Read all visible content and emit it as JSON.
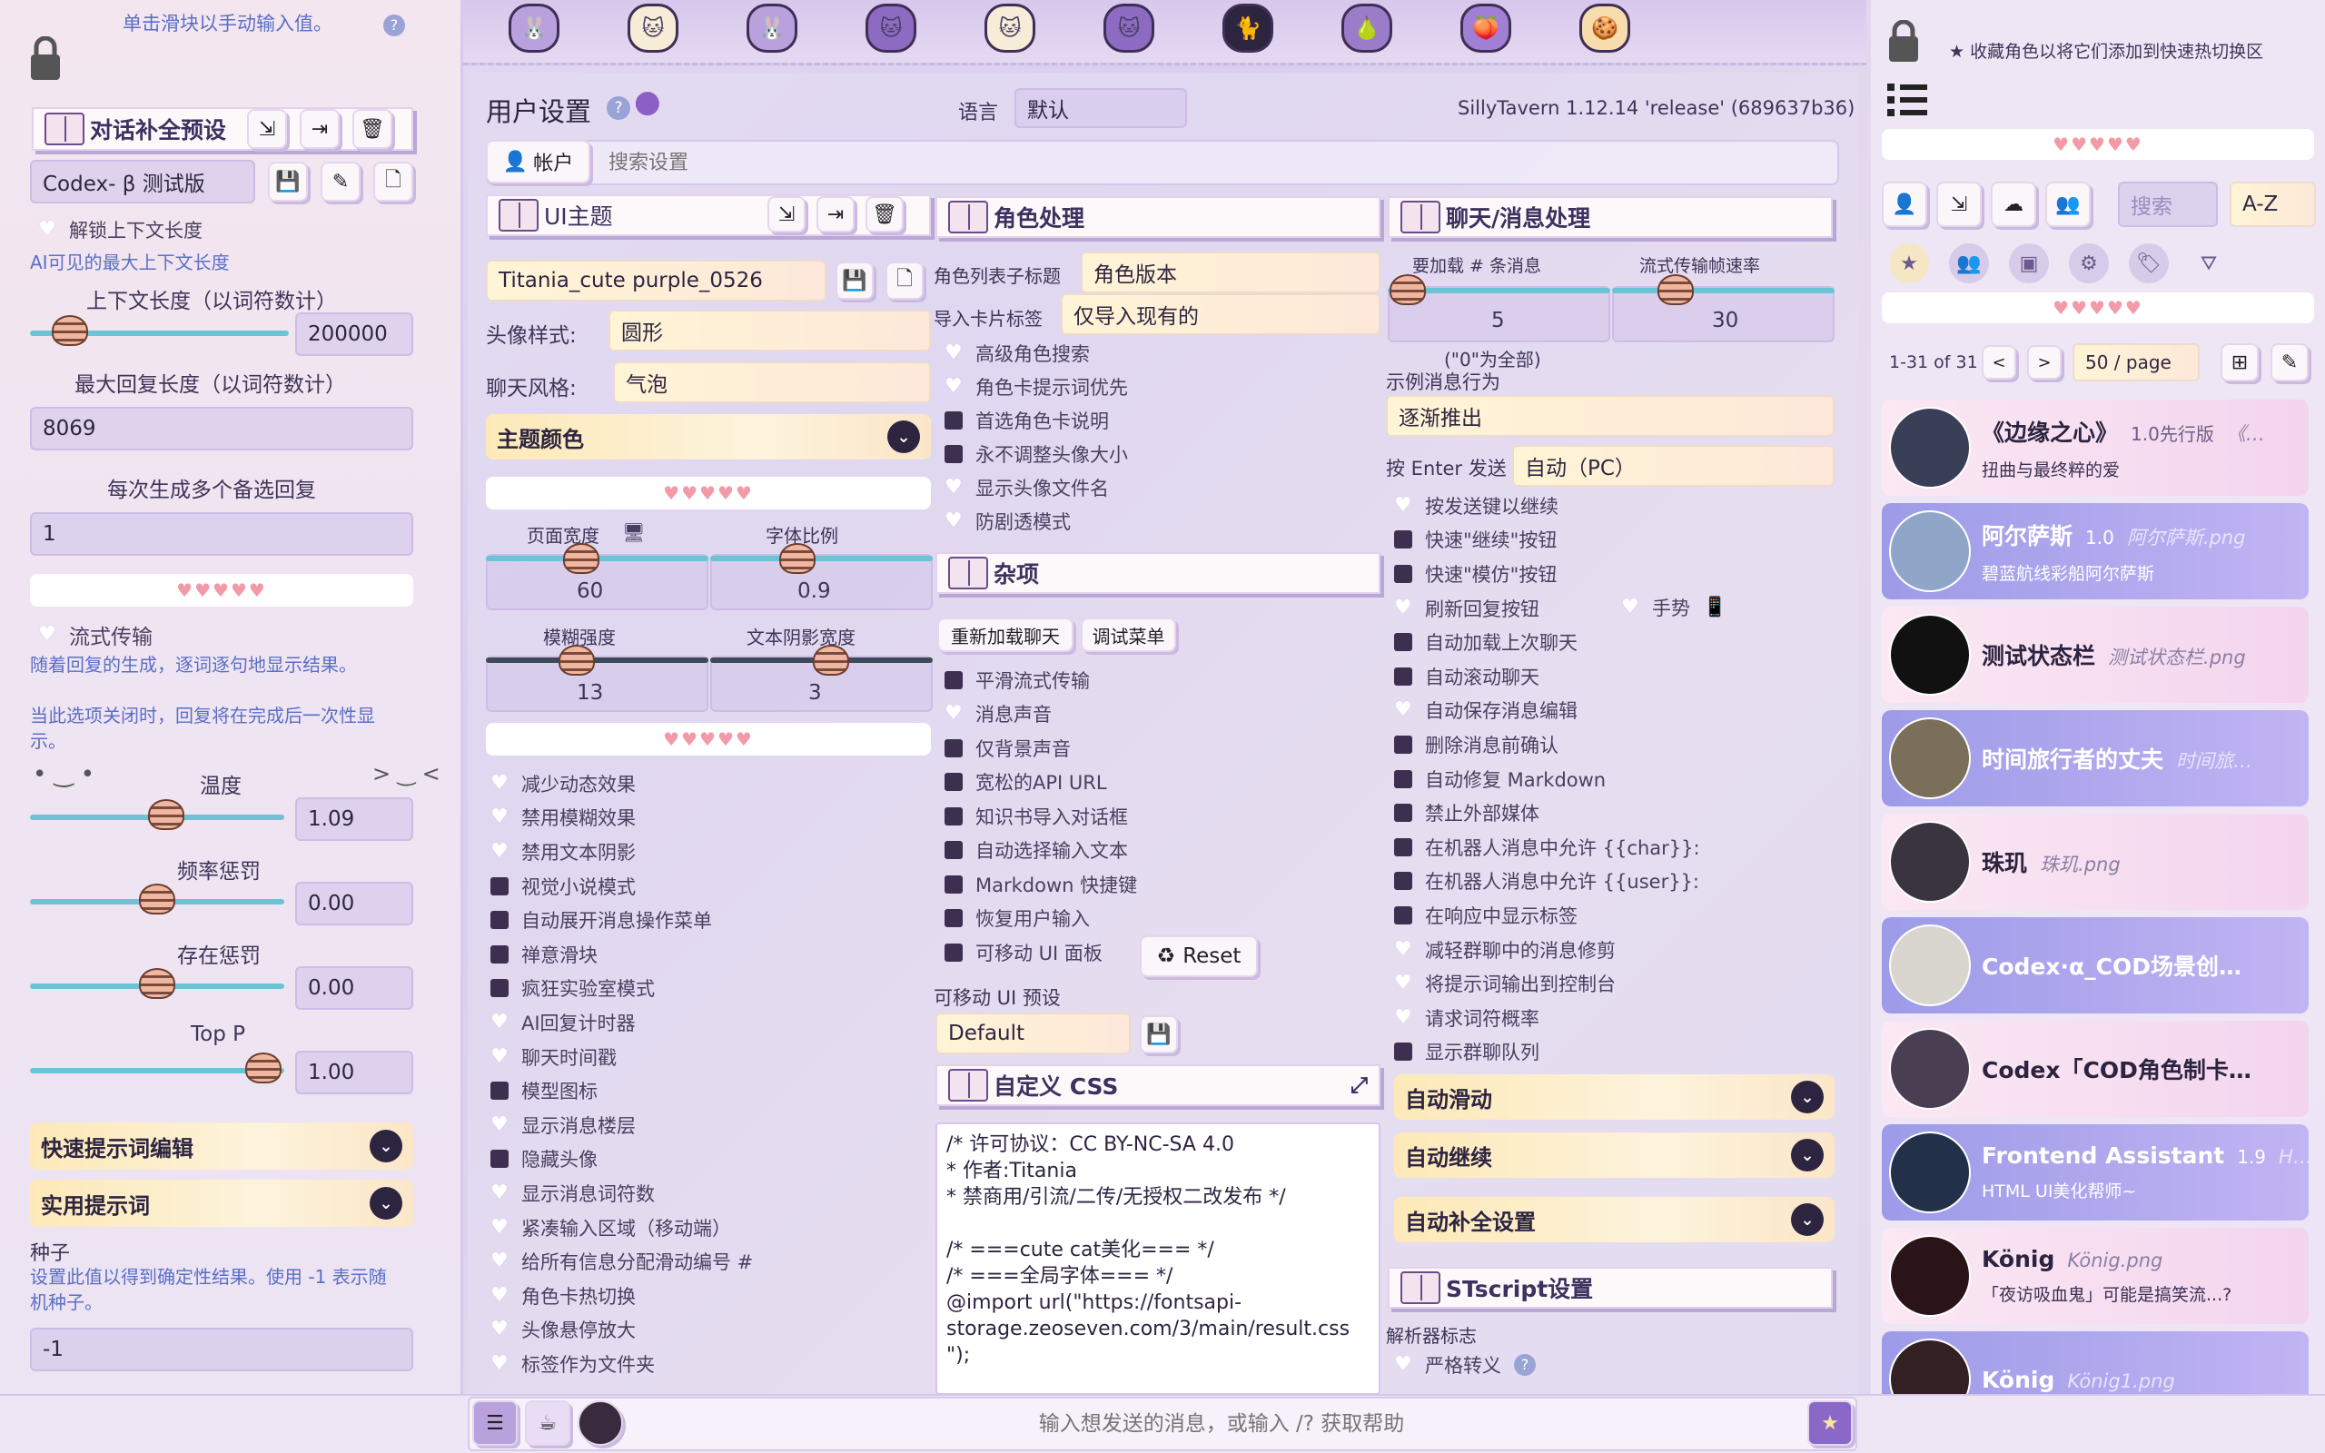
{
  "left": {
    "hint": "单击滑块以手动输入值。",
    "preset_header": "对话补全预设",
    "preset_name": "Codex- β 测试版",
    "unlock_label": "解锁上下文长度",
    "unlock_desc": "AI可见的最大上下文长度",
    "context_label": "上下文长度（以词符数计）",
    "context_value": "200000",
    "max_reply_label": "最大回复长度（以词符数计）",
    "max_reply_value": "8069",
    "multi_label": "每次生成多个备选回复",
    "multi_value": "1",
    "stream_label": "流式传输",
    "stream_desc1": "随着回复的生成，逐词逐句地显示结果。",
    "stream_desc2": "当此选项关闭时，回复将在完成后一次性显示。",
    "temp_label": "温度",
    "temp_value": "1.09",
    "freq_label": "频率惩罚",
    "freq_value": "0.00",
    "pres_label": "存在惩罚",
    "pres_value": "0.00",
    "topp_label": "Top P",
    "topp_value": "1.00",
    "quick_prompt": "快速提示词编辑",
    "util_prompt": "实用提示词",
    "seed_label": "种子",
    "seed_desc": "设置此值以得到确定性结果。使用 -1 表示随机种子。",
    "seed_value": "-1"
  },
  "center": {
    "user_settings": "用户设置",
    "lang_label": "语言",
    "lang_value": "默认",
    "version": "SillyTavern 1.12.14 'release' (689637b36)",
    "account_tab": "帐户",
    "search_placeholder": "搜索设置",
    "ui_theme": {
      "header": "UI主题",
      "theme_name": "Titania_cute purple_0526",
      "avatar_label": "头像样式:",
      "avatar_value": "圆形",
      "chat_label": "聊天风格:",
      "chat_value": "气泡",
      "theme_colors": "主题颜色",
      "page_width_label": "页面宽度",
      "page_width_value": "60",
      "font_scale_label": "字体比例",
      "font_scale_value": "0.9",
      "blur_label": "模糊强度",
      "blur_value": "13",
      "shadow_label": "文本阴影宽度",
      "shadow_value": "3",
      "options": [
        {
          "label": "减少动态效果",
          "state": "heart"
        },
        {
          "label": "禁用模糊效果",
          "state": "heart"
        },
        {
          "label": "禁用文本阴影",
          "state": "heart"
        },
        {
          "label": "视觉小说模式",
          "state": "box"
        },
        {
          "label": "自动展开消息操作菜单",
          "state": "box"
        },
        {
          "label": "禅意滑块",
          "state": "box"
        },
        {
          "label": "疯狂实验室模式",
          "state": "box"
        },
        {
          "label": "AI回复计时器",
          "state": "heart"
        },
        {
          "label": "聊天时间戳",
          "state": "heart"
        },
        {
          "label": "模型图标",
          "state": "box"
        },
        {
          "label": "显示消息楼层",
          "state": "heart"
        },
        {
          "label": "隐藏头像",
          "state": "box"
        },
        {
          "label": "显示消息词符数",
          "state": "heart"
        },
        {
          "label": "紧凑输入区域（移动端）",
          "state": "heart"
        },
        {
          "label": "给所有信息分配滑动编号 #",
          "state": "heart"
        },
        {
          "label": "角色卡热切换",
          "state": "heart"
        },
        {
          "label": "头像悬停放大",
          "state": "heart"
        },
        {
          "label": "标签作为文件夹",
          "state": "heart"
        }
      ]
    },
    "char": {
      "header": "角色处理",
      "list_title_label": "角色列表子标题",
      "list_title_value": "角色版本",
      "import_tags_label": "导入卡片标签",
      "import_tags_value": "仅导入现有的",
      "options": [
        {
          "label": "高级角色搜索",
          "state": "heart"
        },
        {
          "label": "角色卡提示词优先",
          "state": "heart"
        },
        {
          "label": "首选角色卡说明",
          "state": "box"
        },
        {
          "label": "永不调整头像大小",
          "state": "box"
        },
        {
          "label": "显示头像文件名",
          "state": "heart"
        },
        {
          "label": "防剧透模式",
          "state": "heart"
        }
      ]
    },
    "misc": {
      "header": "杂项",
      "reload": "重新加载聊天",
      "debug": "调试菜单",
      "options": [
        {
          "label": "平滑流式传输",
          "state": "box"
        },
        {
          "label": "消息声音",
          "state": "heart"
        },
        {
          "label": "仅背景声音",
          "state": "box"
        },
        {
          "label": "宽松的API URL",
          "state": "box"
        },
        {
          "label": "知识书导入对话框",
          "state": "box"
        },
        {
          "label": "自动选择输入文本",
          "state": "box"
        },
        {
          "label": "Markdown 快捷键",
          "state": "box"
        },
        {
          "label": "恢复用户输入",
          "state": "box"
        },
        {
          "label": "可移动 UI 面板",
          "state": "box"
        }
      ],
      "reset": "Reset",
      "mui_label": "可移动 UI 预设",
      "mui_value": "Default"
    },
    "css": {
      "header": "自定义 CSS",
      "lines": [
        "/* 许可协议：CC BY-NC-SA 4.0",
        "* 作者:Titania",
        "* 禁商用/引流/二传/无授权二改发布 */",
        "",
        "/* ===cute cat美化=== */",
        "/* ===全局字体=== */",
        "@import url(\"https://fontsapi-",
        "storage.zeoseven.com/3/main/result.css",
        "\");"
      ]
    },
    "chat": {
      "header": "聊天/消息处理",
      "lazy_label": "要加载 # 条消息",
      "lazy_value": "5",
      "fps_label": "流式传输帧速率",
      "fps_value": "30",
      "zero_note": "(\"0\"为全部)",
      "example_label": "示例消息行为",
      "example_value": "逐渐推出",
      "enter_label": "按 Enter 发送",
      "enter_value": "自动（PC）",
      "options": [
        {
          "label": "按发送键以继续",
          "state": "heart"
        },
        {
          "label": "快速\"继续\"按钮",
          "state": "box"
        },
        {
          "label": "快速\"模仿\"按钮",
          "state": "box"
        },
        {
          "label": "刷新回复按钮",
          "state": "heart"
        },
        {
          "label": "自动加载上次聊天",
          "state": "box"
        },
        {
          "label": "自动滚动聊天",
          "state": "box"
        },
        {
          "label": "自动保存消息编辑",
          "state": "heart"
        },
        {
          "label": "删除消息前确认",
          "state": "box"
        },
        {
          "label": "自动修复 Markdown",
          "state": "box"
        },
        {
          "label": "禁止外部媒体",
          "state": "box"
        },
        {
          "label": "在机器人消息中允许 {{char}}:",
          "state": "box"
        },
        {
          "label": "在机器人消息中允许 {{user}}:",
          "state": "box"
        },
        {
          "label": "在响应中显示标签",
          "state": "box"
        },
        {
          "label": "减轻群聊中的消息修剪",
          "state": "heart"
        },
        {
          "label": "将提示词输出到控制台",
          "state": "heart"
        },
        {
          "label": "请求词符概率",
          "state": "heart"
        },
        {
          "label": "显示群聊队列",
          "state": "box"
        }
      ],
      "swipe_label": "手势",
      "auto_swipe": "自动滑动",
      "auto_continue": "自动继续",
      "autocomplete": "自动补全设置",
      "stscript": "STscript设置",
      "parser_label": "解析器标志",
      "strict": "严格转义"
    },
    "input_placeholder": "输入想发送的消息，或输入 /? 获取帮助"
  },
  "right": {
    "fav_hint": "收藏角色以将它们添加到快速热切换区",
    "search": "搜索",
    "sort": "A-Z",
    "range": "1-31 of 31",
    "per_page": "50 / page",
    "chars": [
      {
        "name": "《边缘之心》",
        "version": "1.0先行版",
        "file": "《…",
        "desc": "扭曲与最终粹的爱",
        "style": "a",
        "avatar": "#3a3f58"
      },
      {
        "name": "阿尔萨斯",
        "version": "1.0",
        "file": "阿尔萨斯.png",
        "desc": "碧蓝航线彩船阿尔萨斯",
        "style": "b",
        "avatar": "#8fa6c9"
      },
      {
        "name": "测试状态栏",
        "version": "",
        "file": "测试状态栏.png",
        "desc": "",
        "style": "a",
        "avatar": "#111111"
      },
      {
        "name": "时间旅行者的丈夫",
        "version": "",
        "file": "时间旅…",
        "desc": "",
        "style": "b",
        "avatar": "#7a6f5a"
      },
      {
        "name": "珠玑",
        "version": "",
        "file": "珠玑.png",
        "desc": "",
        "style": "a",
        "avatar": "#3a3440"
      },
      {
        "name": "Codex·α_COD场景创…",
        "version": "",
        "file": "",
        "desc": "",
        "style": "b",
        "avatar": "#d9d6d0"
      },
      {
        "name": "Codex「COD角色制卡…",
        "version": "",
        "file": "",
        "desc": "",
        "style": "a",
        "avatar": "#4a3e52"
      },
      {
        "name": "Frontend Assistant",
        "version": "1.9",
        "file": "H…",
        "desc": "HTML UI美化帮师~",
        "style": "b",
        "avatar": "#22304a"
      },
      {
        "name": "König",
        "version": "",
        "file": "König.png",
        "desc": "「夜访吸血鬼」可能是搞笑流...?",
        "style": "a",
        "avatar": "#2a1418"
      },
      {
        "name": "König",
        "version": "",
        "file": "König1.png",
        "desc": "",
        "style": "b",
        "avatar": "#332022"
      }
    ]
  },
  "colors": {
    "accent": "#b9a1dd",
    "dark": "#2d2440",
    "pink": "#f29aa8",
    "slider": "#6bc4d6"
  }
}
